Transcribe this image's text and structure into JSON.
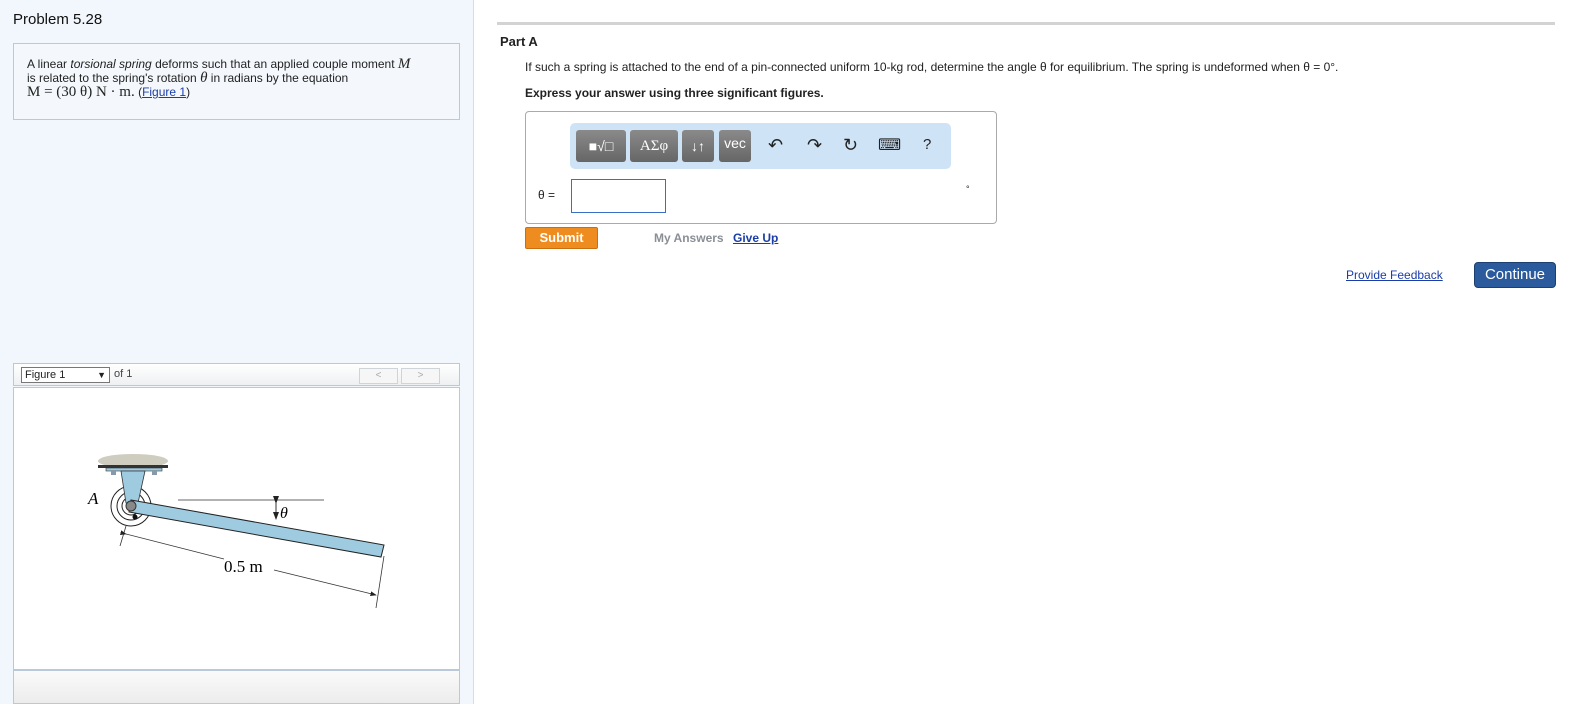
{
  "problem": {
    "title": "Problem 5.28",
    "statement": {
      "t1": "A linear ",
      "t2": "torsional spring",
      "t3": " deforms such that an applied couple moment ",
      "m1": "M",
      "t4": "is related to the spring's rotation ",
      "th": "θ",
      "t5": " in radians by the equation",
      "eq": "M = (30 θ) N · m.",
      "link_open": "(",
      "link": "Figure 1",
      "link_close": ")"
    }
  },
  "figure": {
    "selector": "Figure 1",
    "of": "of 1",
    "prev": "<",
    "next": ">",
    "labels": {
      "point": "A",
      "angle": "θ",
      "length": "0.5 m"
    }
  },
  "part": {
    "title": "Part A",
    "question": "If such a spring is attached to the end of a pin-connected uniform 10-kg rod, determine the angle θ for equilibrium. The spring is undeformed when θ = 0°.",
    "instruction": "Express your answer using three significant figures.",
    "toolbar": {
      "templates": "■√□",
      "greek": "ΑΣφ",
      "arrows": "↓↑",
      "vec": "vec",
      "undo": "↶",
      "redo": "↷",
      "reset": "↻",
      "keyboard": "⌨",
      "help": "?"
    },
    "answer": {
      "label": "θ =",
      "value": "",
      "unit": "°"
    },
    "submit": "Submit",
    "my_answers": "My Answers",
    "give_up": "Give Up"
  },
  "footer": {
    "feedback": "Provide Feedback",
    "continue": "Continue"
  }
}
